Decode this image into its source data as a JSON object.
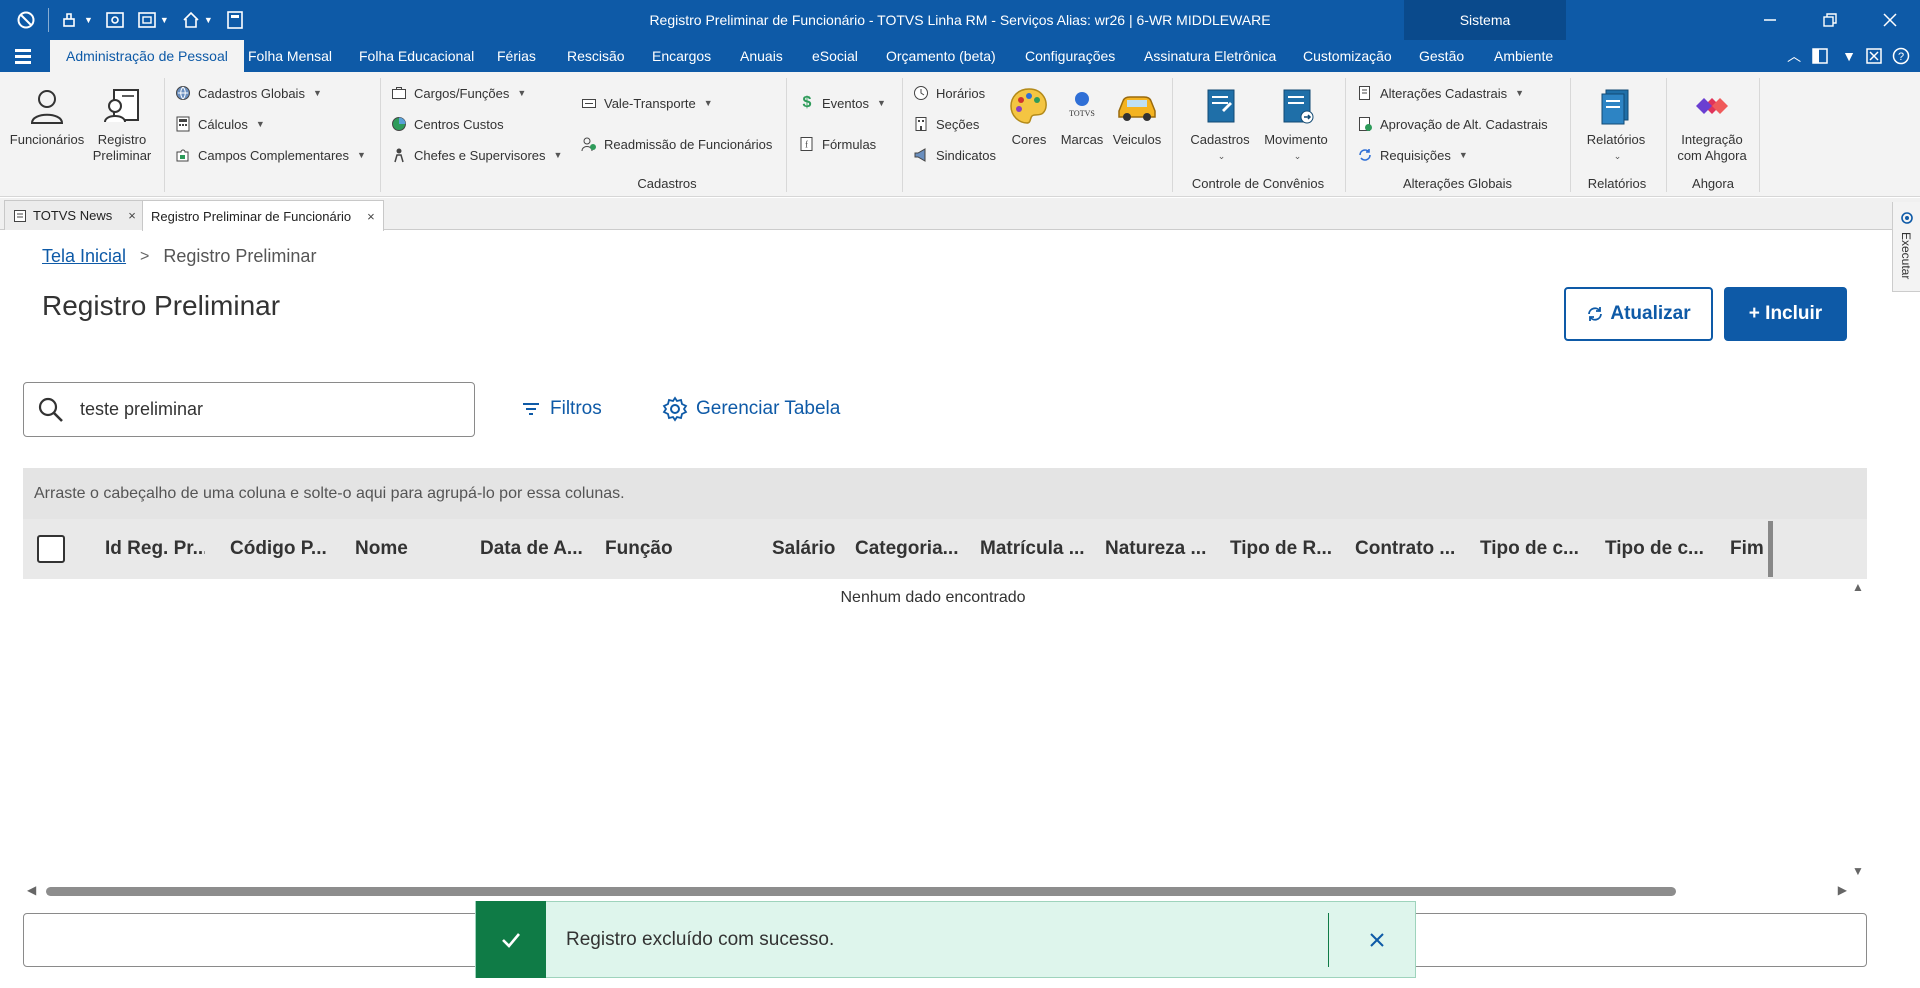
{
  "window": {
    "title": "Registro Preliminar de Funcionário - TOTVS Linha RM - Serviços  Alias: wr26 | 6-WR MIDDLEWARE",
    "sistema_tab": "Sistema"
  },
  "menu": {
    "tabs": [
      "Administração de Pessoal",
      "Folha Mensal",
      "Folha Educacional",
      "Férias",
      "Rescisão",
      "Encargos",
      "Anuais",
      "eSocial",
      "Orçamento (beta)",
      "Configurações",
      "Assinatura Eletrônica",
      "Customização",
      "Gestão",
      "Ambiente"
    ],
    "active_index": 0
  },
  "ribbon": {
    "funcionarios": "Funcionários",
    "registro_preliminar": [
      "Registro",
      "Preliminar"
    ],
    "cadastros_globais": "Cadastros Globais",
    "calculos": "Cálculos",
    "campos_complementares": "Campos Complementares",
    "cargos_funcoes": "Cargos/Funções",
    "centros_custos": "Centros Custos",
    "chefes_supervisores": "Chefes e Supervisores",
    "vale_transporte": "Vale-Transporte",
    "readmissao": "Readmissão de Funcionários",
    "eventos": "Eventos",
    "formulas": "Fórmulas",
    "horarios": "Horários",
    "secoes": "Seções",
    "sindicatos": "Sindicatos",
    "cores": "Cores",
    "marcas": "Marcas",
    "veiculos": "Veiculos",
    "group_cadastros": "Cadastros",
    "cadastros_btn": "Cadastros",
    "movimento_btn": "Movimento",
    "group_convenios": "Controle de Convênios",
    "alteracoes_cadastrais": "Alterações Cadastrais",
    "aprovacao_alt": "Aprovação de Alt. Cadastrais",
    "requisicoes": "Requisições",
    "group_alteracoes": "Alterações Globais",
    "relatorios_btn": "Relatórios",
    "group_relatorios": "Relatórios",
    "integracao": [
      "Integração",
      "com Ahgora"
    ],
    "group_ahgora": "Ahgora",
    "marcas_logo_text": "TOTVS"
  },
  "doctabs": [
    "TOTVS News",
    "Registro Preliminar de Funcionário"
  ],
  "side_panel": {
    "label": "Executar"
  },
  "page": {
    "breadcrumb_home": "Tela Inicial",
    "breadcrumb_current": "Registro Preliminar",
    "title": "Registro Preliminar",
    "btn_refresh": "Atualizar",
    "btn_add": "+ Incluir",
    "search_value": "teste preliminar",
    "filters": "Filtros",
    "manage_table": "Gerenciar Tabela"
  },
  "grid": {
    "group_hint": "Arraste o cabeçalho de uma coluna e solte-o aqui para agrupá-lo por essa colunas.",
    "columns": [
      "Id Reg. Pr...",
      "Código P...",
      "Nome",
      "Data de A...",
      "Função",
      "Salário",
      "Categoria...",
      "Matrícula ...",
      "Natureza ...",
      "Tipo de R...",
      "Contrato ...",
      "Tipo de c...",
      "Tipo de c...",
      "Fim d"
    ],
    "empty_message": "Nenhum dado encontrado"
  },
  "toast": {
    "message": "Registro excluído com sucesso."
  },
  "colors": {
    "brand": "#0e5aa7",
    "success": "#0f7b46",
    "success_bg": "#def5ec"
  }
}
